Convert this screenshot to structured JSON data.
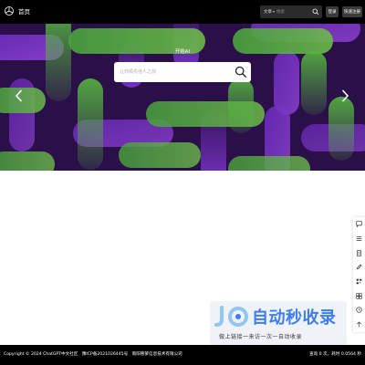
{
  "header": {
    "logo_icon": "openai-logo-icon",
    "nav_home": "首页",
    "search": {
      "type_label": "文章",
      "placeholder": "搜索"
    },
    "login_label": "登录",
    "register_label": "快速注册"
  },
  "hero": {
    "title": "开始AI",
    "search_placeholder": "让你领先他人之前",
    "colors": {
      "background": "#2b0f4a",
      "green": "#5fd93f",
      "purple": "#8a3ce6"
    }
  },
  "side_tools": [
    "chat-icon",
    "list-icon",
    "document-icon",
    "edit-icon",
    "qr-code-icon",
    "grid-icon",
    "clock-icon",
    "up-arrow-icon"
  ],
  "watermark": {
    "title": "自动秒收录",
    "subtitle": "做上链接一来访一次一自动收录"
  },
  "footer": {
    "copyright": "Copyright © 2024 ChatGPT中文社区",
    "icp": "豫ICP备2021026445号",
    "company": "南阳慈萝信息技术有限公司",
    "stats": "查询 0 次，耗时 0.0564 秒"
  }
}
